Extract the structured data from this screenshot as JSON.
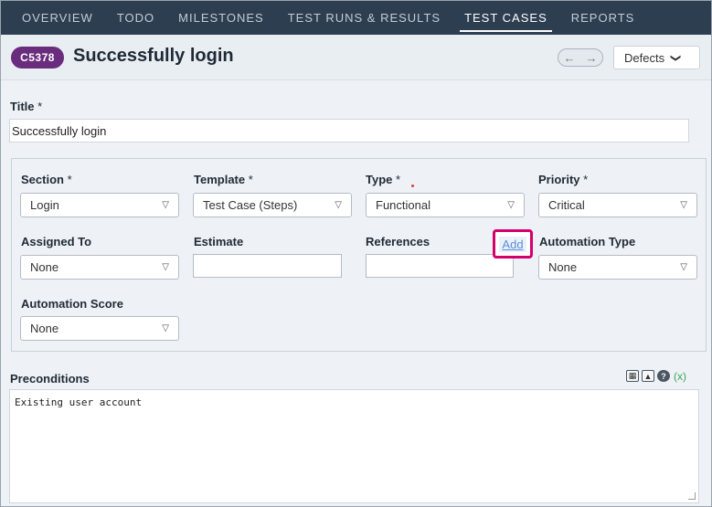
{
  "nav": {
    "tabs": [
      {
        "label": "OVERVIEW"
      },
      {
        "label": "TODO"
      },
      {
        "label": "MILESTONES"
      },
      {
        "label": "TEST RUNS & RESULTS"
      },
      {
        "label": "TEST CASES"
      },
      {
        "label": "REPORTS"
      }
    ],
    "active_tab": "TEST CASES"
  },
  "header": {
    "case_id": "C5378",
    "case_title": "Successfully login",
    "prev_icon": "←",
    "next_icon": "→",
    "defects_label": "Defects"
  },
  "title_field": {
    "label": "Title",
    "required": "*",
    "value": "Successfully login"
  },
  "fields": {
    "section": {
      "label": "Section",
      "required": "*",
      "value": "Login"
    },
    "template": {
      "label": "Template",
      "required": "*",
      "value": "Test Case (Steps)"
    },
    "type": {
      "label": "Type",
      "required": "*",
      "value": "Functional"
    },
    "priority": {
      "label": "Priority",
      "required": "*",
      "value": "Critical"
    },
    "assigned_to": {
      "label": "Assigned To",
      "value": "None"
    },
    "estimate": {
      "label": "Estimate",
      "value": ""
    },
    "references": {
      "label": "References",
      "value": "",
      "add_label": "Add"
    },
    "automation_type": {
      "label": "Automation Type",
      "value": "None"
    },
    "automation_score": {
      "label": "Automation Score",
      "value": "None"
    }
  },
  "preconditions": {
    "label": "Preconditions",
    "value": "Existing user account"
  },
  "colors": {
    "nav_bg": "#2d3e50",
    "badge": "#6a2c7c",
    "highlight": "#d4006d",
    "link": "#5b8ed6"
  }
}
